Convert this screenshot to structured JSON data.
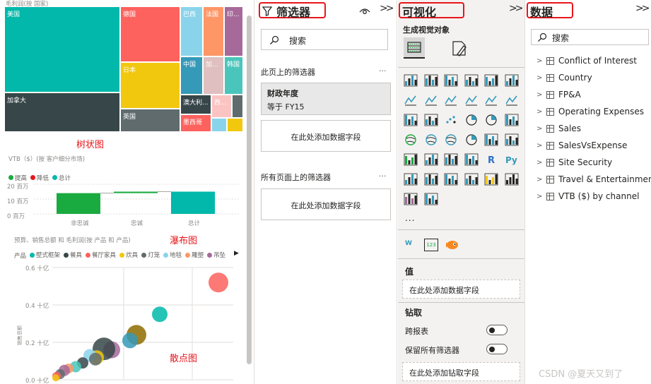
{
  "treemap": {
    "subtitle": "毛利润(按 国家)",
    "label": "树状图",
    "cells": [
      {
        "name": "美国",
        "color": "#01b8aa"
      },
      {
        "name": "德国",
        "color": "#fd625e"
      },
      {
        "name": "巴西",
        "color": "#8ad4eb"
      },
      {
        "name": "法国",
        "color": "#fe9666"
      },
      {
        "name": "印...",
        "color": "#a66999"
      },
      {
        "name": "日本",
        "color": "#f2c80f"
      },
      {
        "name": "中国",
        "color": "#3599b8"
      },
      {
        "name": "加...",
        "color": "#dfbfbf"
      },
      {
        "name": "韩国",
        "color": "#4ac5bb"
      },
      {
        "name": "加拿大",
        "color": "#374649"
      },
      {
        "name": "英国",
        "color": "#5f6b6d"
      },
      {
        "name": "澳大利...",
        "color": "#374649"
      },
      {
        "name": "西...",
        "color": "#fbc4c2"
      },
      {
        "name": "墨西哥",
        "color": "#fd625e"
      }
    ]
  },
  "waterfall": {
    "subtitle": "VTB（$）(按 客户细分市场)",
    "label": "瀑布图",
    "legend": [
      {
        "name": "提高",
        "color": "#1aab40"
      },
      {
        "name": "降低",
        "color": "#e8151b"
      },
      {
        "name": "总计",
        "color": "#01b8aa"
      }
    ],
    "y_ticks": [
      "20 百万",
      "10 百万",
      "0 百万"
    ],
    "categories": [
      "非忠诚",
      "忠诚",
      "总计"
    ]
  },
  "scatter": {
    "subtitle": "预算、销售总额 和 毛利润(按 产品 和 产品)",
    "label": "散点图",
    "legend_title": "产品",
    "legend": [
      {
        "name": "壁式框架",
        "color": "#01b8aa"
      },
      {
        "name": "餐具",
        "color": "#374649"
      },
      {
        "name": "餐厅家具",
        "color": "#fd625e"
      },
      {
        "name": "炊具",
        "color": "#f2c80f"
      },
      {
        "name": "灯笼",
        "color": "#5f6b6d"
      },
      {
        "name": "地毯",
        "color": "#8ad4eb"
      },
      {
        "name": "雕塑",
        "color": "#fe9666"
      },
      {
        "name": "吊坠",
        "color": "#a66999"
      }
    ],
    "y_ticks": [
      "0.6 十亿",
      "0.4 十亿",
      "0.2 十亿",
      "0.0 十亿"
    ],
    "ylabel": "销售总额"
  },
  "filters": {
    "title": "筛选器",
    "search_placeholder": "搜索",
    "page_section": "此页上的筛选器",
    "card_title": "财政年度",
    "card_value": "等于 FY15",
    "add_field": "在此处添加数据字段",
    "all_pages_section": "所有页面上的筛选器",
    "add_field_2": "在此处添加数据字段",
    "more": "..."
  },
  "visualizations": {
    "title": "可视化",
    "build_label": "生成视觉对象",
    "more": "...",
    "values_label": "值",
    "values_add": "在此处添加数据字段",
    "drill_label": "钻取",
    "cross_report": "跨报表",
    "keep_filters": "保留所有筛选器",
    "drill_add": "在此处添加钻取字段"
  },
  "data": {
    "title": "数据",
    "search_placeholder": "搜索",
    "tables": [
      "Conflict of Interest",
      "Country",
      "FP&A",
      "Operating Expenses",
      "Sales",
      "SalesVsExpense",
      "Site Security",
      "Travel & Entertainment",
      "VTB ($) by channel"
    ]
  },
  "watermark": "CSDN @夏天又到了",
  "chart_data": [
    {
      "type": "bar",
      "title": "VTB（$）(按 客户细分市场)",
      "categories": [
        "非忠诚",
        "忠诚",
        "总计"
      ],
      "series": [
        {
          "values": [
            14,
            1,
            15
          ]
        }
      ],
      "ylabel": "",
      "ylim": [
        0,
        20
      ]
    },
    {
      "type": "scatter",
      "title": "预算、销售总额 和 毛利润(按 产品 和 产品)",
      "ylabel": "销售总额",
      "ylim": [
        0,
        0.6
      ],
      "series": [
        {
          "name": "雕塑",
          "values": [
            0.52
          ]
        },
        {
          "name": "壁式框架",
          "values": [
            0.35
          ]
        },
        {
          "name": "炊具",
          "values": [
            0.24
          ]
        }
      ]
    }
  ]
}
